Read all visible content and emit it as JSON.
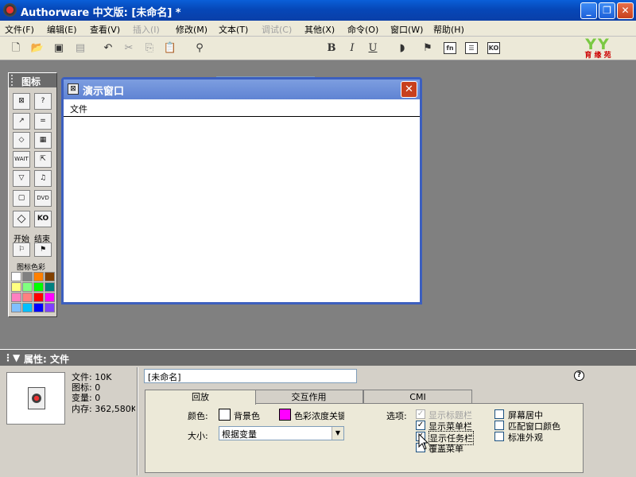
{
  "window": {
    "title": "Authorware 中文版: [未命名] *"
  },
  "menu": [
    {
      "label": "文件(F)",
      "enabled": true
    },
    {
      "label": "编辑(E)",
      "enabled": true
    },
    {
      "label": "查看(V)",
      "enabled": true
    },
    {
      "label": "插入(I)",
      "enabled": false
    },
    {
      "label": "修改(M)",
      "enabled": true
    },
    {
      "label": "文本(T)",
      "enabled": true
    },
    {
      "label": "调试(C)",
      "enabled": false
    },
    {
      "label": "其他(X)",
      "enabled": true
    },
    {
      "label": "命令(O)",
      "enabled": true
    },
    {
      "label": "窗口(W)",
      "enabled": true
    },
    {
      "label": "帮助(H)",
      "enabled": true
    }
  ],
  "toolbar": {
    "bold": "B",
    "italic": "I",
    "underline": "U",
    "fn_label": "fn",
    "ko_label": "KO",
    "font_value": ""
  },
  "logo": {
    "mark": "YY",
    "text": "育 缘 苑"
  },
  "icon_palette": {
    "title": "图标",
    "icons": [
      {
        "name": "display",
        "glyph": "⊠"
      },
      {
        "name": "interaction",
        "glyph": "?"
      },
      {
        "name": "motion",
        "glyph": "↗"
      },
      {
        "name": "calculation",
        "glyph": "="
      },
      {
        "name": "erase",
        "glyph": "◇"
      },
      {
        "name": "framework",
        "glyph": "▦"
      },
      {
        "name": "wait",
        "glyph": "WAIT"
      },
      {
        "name": "navigate",
        "glyph": "⇱"
      },
      {
        "name": "decision",
        "glyph": "▽"
      },
      {
        "name": "sound",
        "glyph": "♫"
      },
      {
        "name": "map",
        "glyph": "▢"
      },
      {
        "name": "video",
        "glyph": "DVD"
      },
      {
        "name": "digital-movie",
        "glyph": "◇"
      },
      {
        "name": "knowledge-object",
        "glyph": "KO"
      }
    ],
    "start_label": "开始",
    "end_label": "结束",
    "colors_label": "图标色彩",
    "swatches": [
      "#ffffff",
      "#808080",
      "#ff8000",
      "#804000",
      "#ffff80",
      "#80ff80",
      "#00ff00",
      "#008080",
      "#ff80c0",
      "#ff8080",
      "#ff0000",
      "#ff00ff",
      "#80c0ff",
      "#00c0ff",
      "#0000ff",
      "#8040ff"
    ]
  },
  "presentation": {
    "title": "演示窗口",
    "menu_file": "文件"
  },
  "properties": {
    "header": "属性: 文件",
    "info": {
      "file": "文件: 10K",
      "icons": "图标: 0",
      "vars": "变量: 0",
      "memory": "内存: 362,580K"
    },
    "name_value": "[未命名]",
    "tabs": [
      "回放",
      "交互作用",
      "CMI"
    ],
    "color_label": "颜色:",
    "bg_color_label": "背景色",
    "chroma_label": "色彩浓度关键色",
    "size_label": "大小:",
    "size_value": "根据变量",
    "options_label": "选项:",
    "options": [
      {
        "label": "显示标题栏",
        "checked": true,
        "enabled": false
      },
      {
        "label": "显示菜单栏",
        "checked": true,
        "enabled": true
      },
      {
        "label": "显示任务栏",
        "checked": true,
        "enabled": true
      },
      {
        "label": "覆盖菜单",
        "checked": false,
        "enabled": true
      }
    ],
    "options_right": [
      {
        "label": "屏幕居中",
        "checked": false
      },
      {
        "label": "匹配窗口颜色",
        "checked": false
      },
      {
        "label": "标准外观",
        "checked": false
      }
    ],
    "bg_color": "#ffffff",
    "chroma_color": "#ff00ff"
  }
}
